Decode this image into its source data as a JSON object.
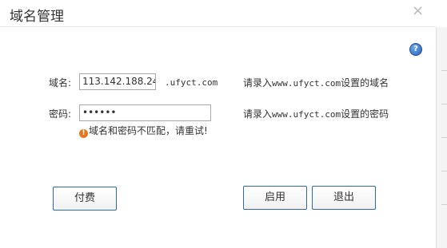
{
  "dialog": {
    "title": "域名管理",
    "close_symbol": "×",
    "help_symbol": "?"
  },
  "form": {
    "domain": {
      "label": "域名:",
      "value": "113.142.188.24",
      "suffix": ".ufyct.com",
      "hint_prefix": "请录入",
      "hint_domain": "www.ufyct.com",
      "hint_suffix": "设置的域名"
    },
    "password": {
      "label": "密码:",
      "value": "••••••",
      "hint_prefix": "请录入",
      "hint_domain": "www.ufyct.com",
      "hint_suffix": "设置的密码"
    },
    "error": {
      "icon": "!",
      "message": "域名和密码不匹配，请重试!"
    }
  },
  "buttons": {
    "pay": "付费",
    "enable": "启用",
    "exit": "退出"
  },
  "icons": {
    "close": "close-icon",
    "help": "help-icon",
    "error": "warning-icon"
  }
}
